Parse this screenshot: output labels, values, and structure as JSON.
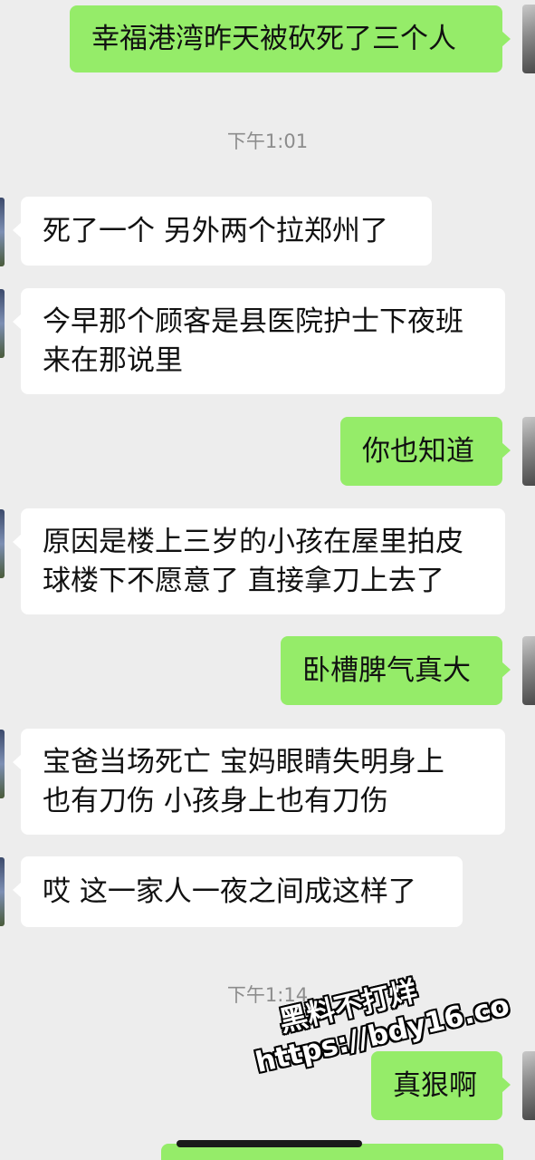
{
  "messages": [
    {
      "side": "out",
      "text": "幸福港湾昨天被砍死了三个人"
    },
    {
      "side": "in",
      "text": "死了一个 另外两个拉郑州了"
    },
    {
      "side": "in",
      "line1": "今早那个顾客是县医院护士下夜班",
      "line2": "来在那说里"
    },
    {
      "side": "out",
      "text": "你也知道"
    },
    {
      "side": "in",
      "line1": "原因是楼上三岁的小孩在屋里拍皮",
      "line2": "球楼下不愿意了 直接拿刀上去了"
    },
    {
      "side": "out",
      "text": "卧槽脾气真大"
    },
    {
      "side": "in",
      "line1": "宝爸当场死亡 宝妈眼睛失明身上",
      "line2": "也有刀伤 小孩身上也有刀伤"
    },
    {
      "side": "in",
      "text": "哎 这一家人一夜之间成这样了"
    },
    {
      "side": "out",
      "text": "真狠啊"
    }
  ],
  "timestamps": [
    "下午1:01",
    "下午1:14"
  ],
  "watermark": {
    "line1": "黑料不打烊",
    "line2": "https://bdy16.co"
  },
  "colors": {
    "outgoing_bubble": "#95ec69",
    "incoming_bubble": "#ffffff",
    "background": "#ededed"
  }
}
